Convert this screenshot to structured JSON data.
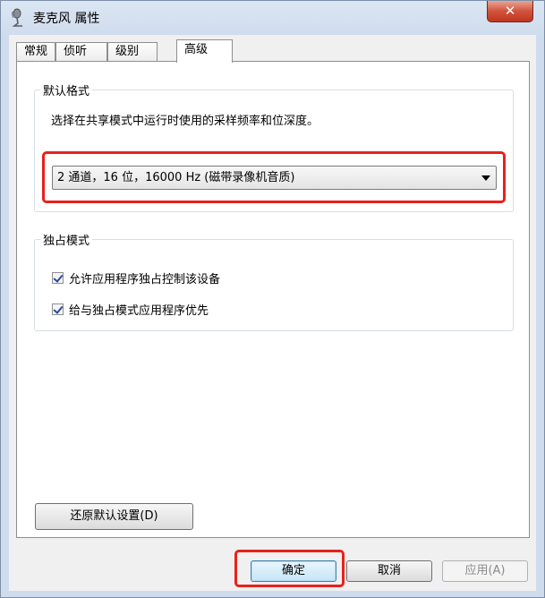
{
  "window": {
    "title": "麦克风 属性",
    "close_label": "✕"
  },
  "tabs": [
    {
      "label": "常规"
    },
    {
      "label": "侦听"
    },
    {
      "label": "级别"
    },
    {
      "label": "高级"
    }
  ],
  "default_format": {
    "group_label": "默认格式",
    "description": "选择在共享模式中运行时使用的采样频率和位深度。",
    "selected_value": "2 通道，16 位，16000 Hz (磁带录像机音质)"
  },
  "exclusive_mode": {
    "group_label": "独占模式",
    "options": [
      {
        "label": "允许应用程序独占控制该设备",
        "checked": true
      },
      {
        "label": "给与独占模式应用程序优先",
        "checked": true
      }
    ]
  },
  "restore_button": "还原默认设置(D)",
  "footer": {
    "ok": "确定",
    "cancel": "取消",
    "apply": "应用(A)"
  },
  "colors": {
    "highlight": "#e8211c",
    "close_button": "#c0361f"
  }
}
